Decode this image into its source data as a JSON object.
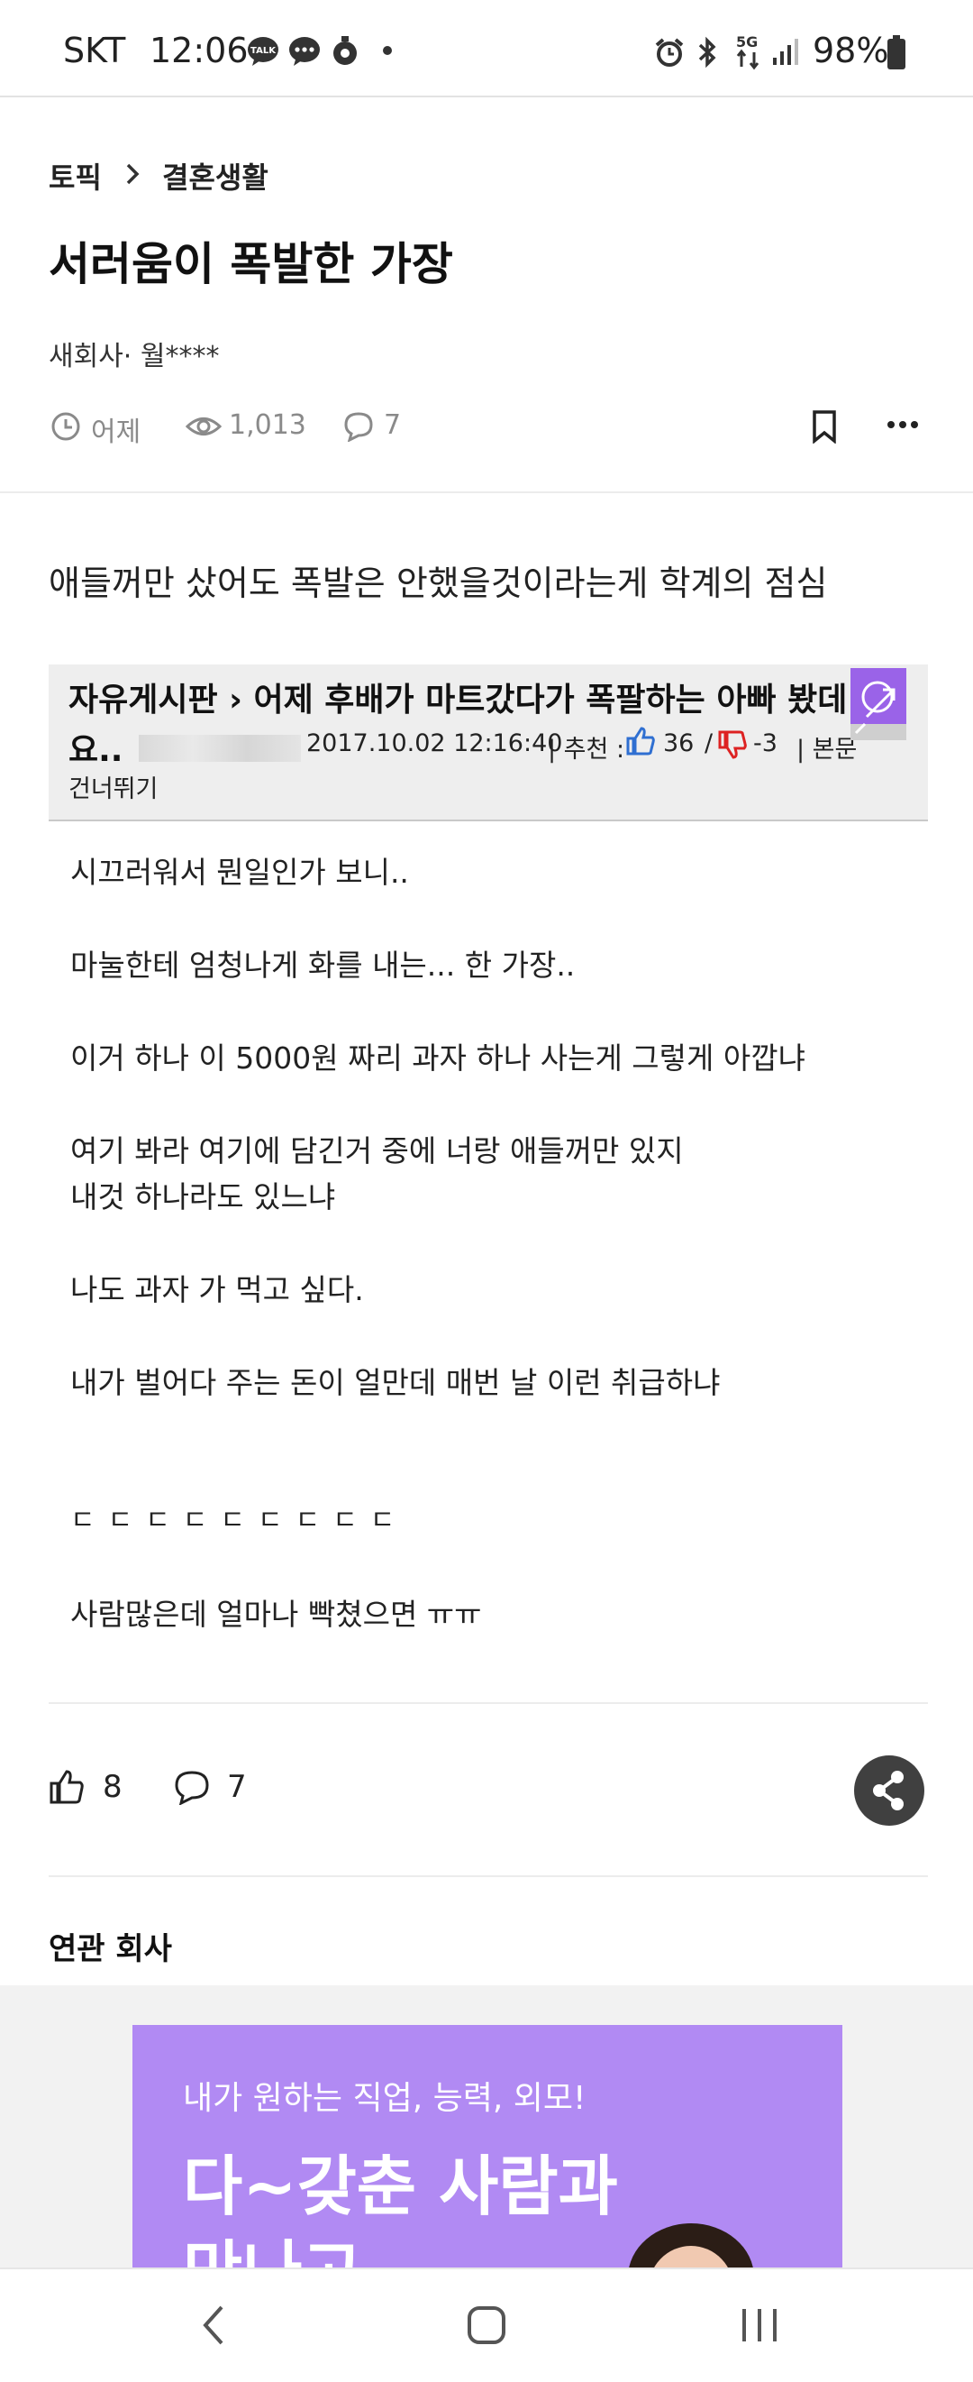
{
  "status_bar": {
    "carrier": "SKT",
    "time": "12:06",
    "battery": "98%",
    "network": "5G"
  },
  "breadcrumb": {
    "topic": "토픽",
    "category": "결혼생활"
  },
  "post": {
    "title": "서러움이 폭발한 가장",
    "author": "새회사· 월****",
    "time": "어제",
    "views": "1,013",
    "comments": "7",
    "intro": "애들꺼만 샀어도 폭발은 안했을것이라는게 학계의 점심"
  },
  "embed": {
    "header_line1": "자유게시판 › 어제 후배가 마트갔다가 폭팔하는 아빠 봤데",
    "header_line2_prefix": "요..",
    "date": "2017.10.02 12:16:40",
    "rec_label": "| 추천 :",
    "likes": "36",
    "slash": "/",
    "dislikes": "-3",
    "tail": "| 본문",
    "skip": "건너뛰기",
    "lines": [
      "시끄러워서 뭔일인가 보니..",
      "마눌한테 엄청나게 화를 내는... 한 가장..",
      "이거 하나 이 5000원 짜리 과자 하나 사는게 그렇게 아깝냐",
      "여기 봐라 여기에 담긴거 중에 너랑 애들꺼만 있지",
      "내것 하나라도 있느냐",
      "나도 과자 가 먹고 싶다.",
      "내가 벌어다 주는 돈이 얼만데 매번 날 이런 취급하냐",
      "ㄷㄷㄷㄷㄷㄷㄷㄷㄷ",
      "사람많은데 얼마나 빡쳤으면 ㅠㅠ"
    ]
  },
  "actions": {
    "likes": "8",
    "comments": "7"
  },
  "related": {
    "title": "연관 회사"
  },
  "ad": {
    "line1": "내가 원하는 직업, 능력, 외모!",
    "line2": "다~갖춘 사람과",
    "line3": "만나고"
  },
  "colors": {
    "accent": "#b18af3",
    "share_button": "#404040",
    "like_blue": "#2f6fd1",
    "dislike_red": "#d22"
  }
}
